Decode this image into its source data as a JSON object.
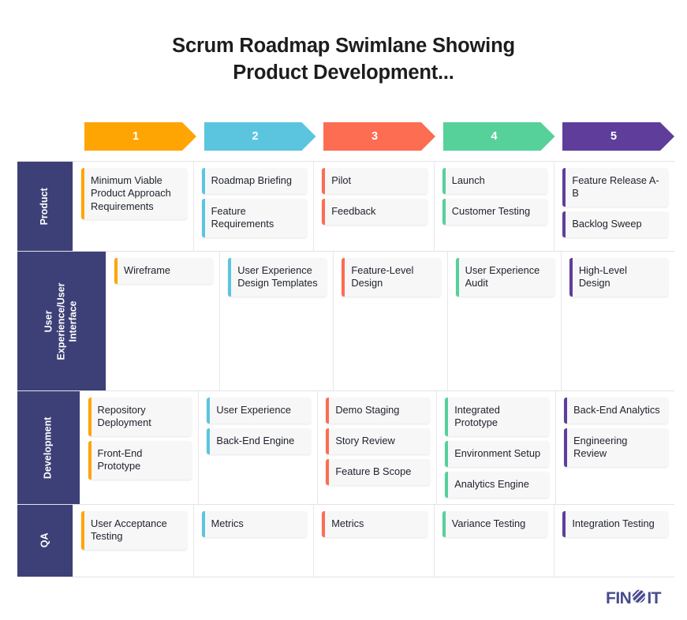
{
  "title": "Scrum Roadmap Swimlane Showing\nProduct Development...",
  "title_line1": "Scrum Roadmap Swimlane Showing",
  "title_line2": "Product Development...",
  "colors": {
    "stage1": "#ffa503",
    "stage2": "#5bc5e0",
    "stage3": "#fc6d52",
    "stage4": "#55d199",
    "stage5": "#5f3e9b",
    "row_label_bg": "#3d4077",
    "card_bg": "#f7f7f8",
    "logo": "#474b8f",
    "title_text": "#1d1d1f",
    "grid_line": "#e3e3e8"
  },
  "stages": [
    {
      "label": "1",
      "color": "#ffa503"
    },
    {
      "label": "2",
      "color": "#5bc5e0"
    },
    {
      "label": "3",
      "color": "#fc6d52"
    },
    {
      "label": "4",
      "color": "#55d199"
    },
    {
      "label": "5",
      "color": "#5f3e9b"
    }
  ],
  "swimlanes": [
    {
      "label": "Product",
      "cells": [
        {
          "cards": [
            "Minimum Viable Product Approach Requirements"
          ]
        },
        {
          "cards": [
            "Roadmap Briefing",
            "Feature Requirements"
          ]
        },
        {
          "cards": [
            "Pilot",
            "Feedback"
          ]
        },
        {
          "cards": [
            "Launch",
            "Customer Testing"
          ]
        },
        {
          "cards": [
            "Feature Release A-B",
            "Backlog Sweep"
          ]
        }
      ]
    },
    {
      "label": "User Experience/User Interface",
      "cells": [
        {
          "cards": [
            "Wireframe"
          ]
        },
        {
          "cards": [
            "User Experience Design Templates"
          ]
        },
        {
          "cards": [
            "Feature-Level Design"
          ]
        },
        {
          "cards": [
            "User Experience Audit"
          ]
        },
        {
          "cards": [
            "High-Level Design"
          ]
        }
      ]
    },
    {
      "label": "Development",
      "cells": [
        {
          "cards": [
            "Repository Deployment",
            "Front-End Prototype"
          ]
        },
        {
          "cards": [
            "User Experience",
            "Back-End Engine"
          ]
        },
        {
          "cards": [
            "Demo Staging",
            "Story Review",
            "Feature B Scope"
          ]
        },
        {
          "cards": [
            "Integrated Prototype",
            "Environment Setup",
            "Analytics Engine"
          ]
        },
        {
          "cards": [
            "Back-End Analytics",
            "Engineering Review"
          ]
        }
      ]
    },
    {
      "label": "QA",
      "cells": [
        {
          "cards": [
            "User Acceptance Testing"
          ]
        },
        {
          "cards": [
            "Metrics"
          ]
        },
        {
          "cards": [
            "Metrics"
          ]
        },
        {
          "cards": [
            "Variance Testing"
          ]
        },
        {
          "cards": [
            "Integration Testing"
          ]
        }
      ]
    }
  ],
  "logo": {
    "prefix": "FIN",
    "suffix": "IT",
    "icon": "striped-circle-icon"
  }
}
